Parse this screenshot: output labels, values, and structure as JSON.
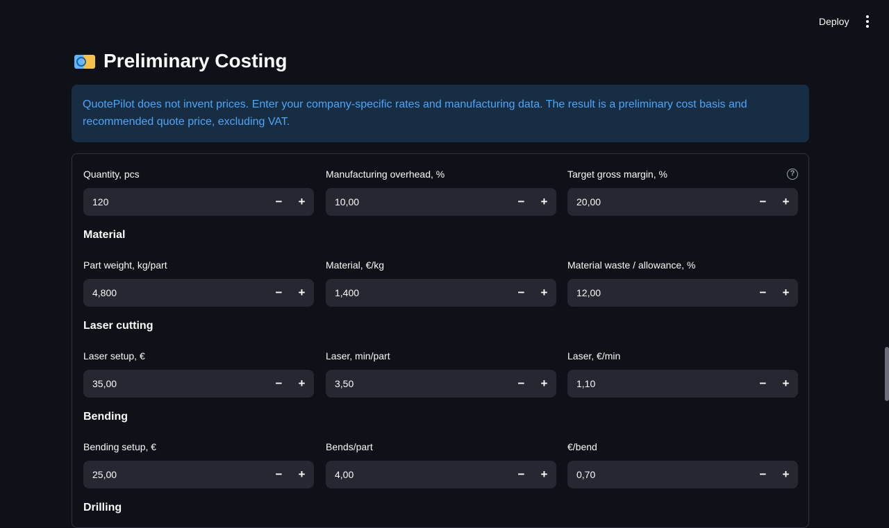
{
  "toolbar": {
    "deploy_label": "Deploy",
    "menu_icon": "kebab-menu-icon"
  },
  "page": {
    "title": "Preliminary Costing",
    "title_icon": "money-icon"
  },
  "info": {
    "text": "QuotePilot does not invent prices. Enter your company-specific rates and manufacturing data. The result is a preliminary cost basis and recommended quote price, excluding VAT."
  },
  "form": {
    "general": {
      "quantity": {
        "label": "Quantity, pcs",
        "value": "120"
      },
      "overhead": {
        "label": "Manufacturing overhead, %",
        "value": "10,00"
      },
      "margin": {
        "label": "Target gross margin, %",
        "value": "20,00"
      }
    },
    "material": {
      "heading": "Material",
      "weight": {
        "label": "Part weight, kg/part",
        "value": "4,800"
      },
      "price": {
        "label": "Material, €/kg",
        "value": "1,400"
      },
      "waste": {
        "label": "Material waste / allowance, %",
        "value": "12,00"
      }
    },
    "laser": {
      "heading": "Laser cutting",
      "setup": {
        "label": "Laser setup, €",
        "value": "35,00"
      },
      "minutes": {
        "label": "Laser, min/part",
        "value": "3,50"
      },
      "rate": {
        "label": "Laser, €/min",
        "value": "1,10"
      }
    },
    "bending": {
      "heading": "Bending",
      "setup": {
        "label": "Bending setup, €",
        "value": "25,00"
      },
      "bends": {
        "label": "Bends/part",
        "value": "4,00"
      },
      "per_bend": {
        "label": "€/bend",
        "value": "0,70"
      }
    },
    "drilling": {
      "heading": "Drilling"
    }
  },
  "stepper": {
    "minus": "−",
    "plus": "+"
  },
  "help_glyph": "?"
}
